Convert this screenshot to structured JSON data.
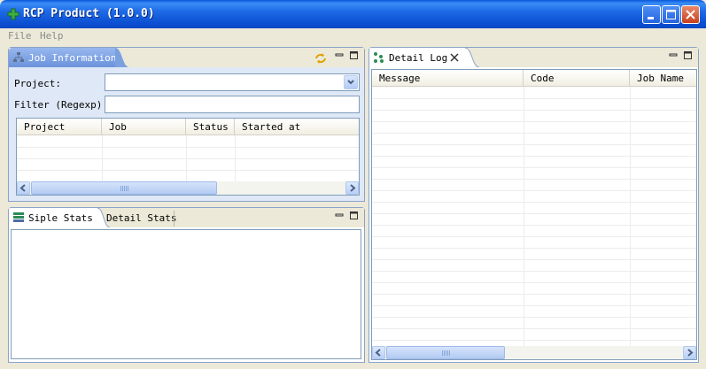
{
  "window": {
    "title": "RCP Product (1.0.0)",
    "icon": "green-plus-icon"
  },
  "menu": [
    {
      "label": "File",
      "key": "F"
    },
    {
      "label": "Help",
      "key": "H"
    }
  ],
  "job_panel": {
    "tab_label": "Job Information",
    "project_label": "Project:",
    "project_value": "",
    "filter_label": "Filter (Regexp):",
    "filter_value": "",
    "columns": [
      "Project",
      "Job",
      "Status",
      "Started at"
    ]
  },
  "stats_panel": {
    "tabs": [
      "Siple Stats",
      "Detail Stats"
    ]
  },
  "log_panel": {
    "tab_label": "Detail Log",
    "columns": [
      "Message",
      "Code",
      "Job Name"
    ]
  },
  "colors": {
    "titlebar": "#0b4ed0",
    "active_tab": "#7aa0e0",
    "panel_border": "#8aa3c8"
  }
}
